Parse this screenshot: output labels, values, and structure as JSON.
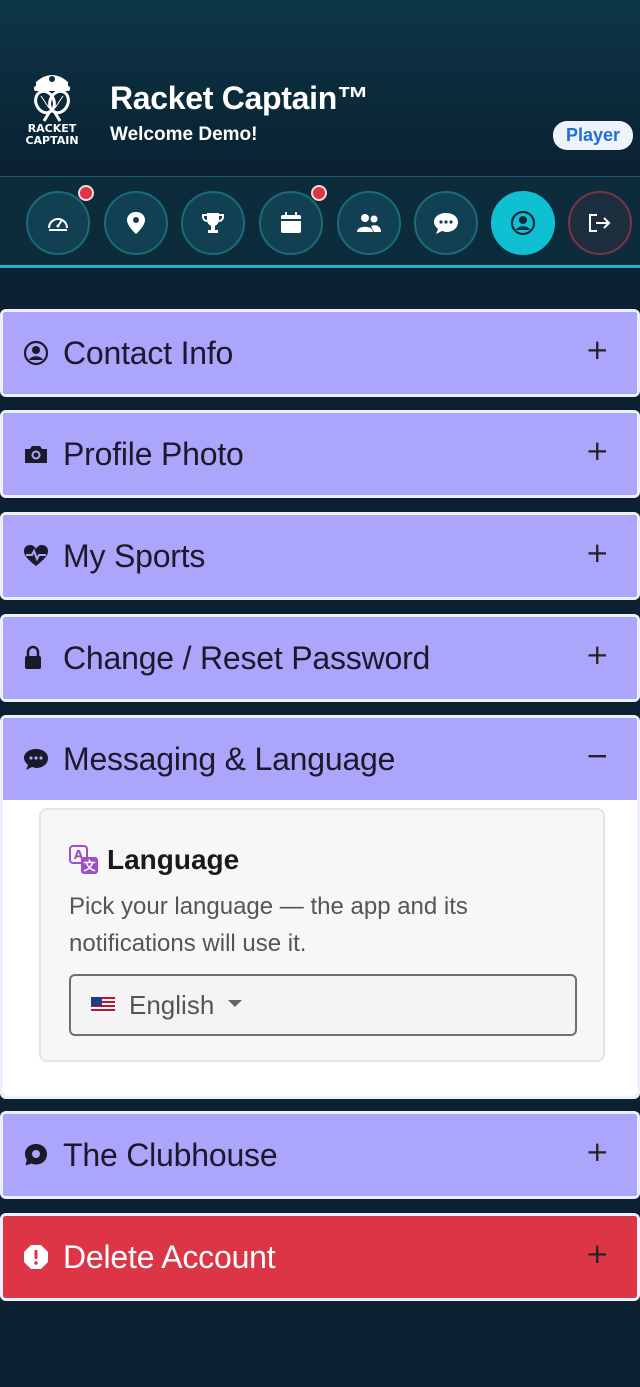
{
  "header": {
    "logo_text_line1": "RACKET",
    "logo_text_line2": "CAPTAIN",
    "title": "Racket Captain™",
    "welcome": "Welcome Demo!",
    "role_badge": "Player"
  },
  "nav": {
    "items": [
      {
        "icon": "speedometer-icon",
        "has_notification": true
      },
      {
        "icon": "location-pin-icon",
        "has_notification": false
      },
      {
        "icon": "trophy-icon",
        "has_notification": false
      },
      {
        "icon": "calendar-icon",
        "has_notification": true
      },
      {
        "icon": "people-icon",
        "has_notification": false
      },
      {
        "icon": "chat-icon",
        "has_notification": false
      },
      {
        "icon": "user-circle-icon",
        "active": true
      },
      {
        "icon": "logout-icon",
        "has_notification": false
      }
    ]
  },
  "sections": [
    {
      "label": "Contact Info",
      "icon": "user-circle-icon",
      "toggle": "+"
    },
    {
      "label": "Profile Photo",
      "icon": "camera-icon",
      "toggle": "+"
    },
    {
      "label": "My Sports",
      "icon": "heart-pulse-icon",
      "toggle": "+"
    },
    {
      "label": "Change / Reset Password",
      "icon": "lock-icon",
      "toggle": "+"
    },
    {
      "label": "Messaging & Language",
      "icon": "chat-dots-icon",
      "toggle": "−",
      "expanded": true
    },
    {
      "label": "The Clubhouse",
      "icon": "chat-bubble-icon",
      "toggle": "+"
    },
    {
      "label": "Delete Account",
      "icon": "exclamation-octagon-icon",
      "toggle": "+"
    }
  ],
  "language": {
    "title": "Language",
    "description": "Pick your language — the app and its notifications will use it.",
    "selected": "English",
    "flag": "us-flag-icon"
  },
  "colors": {
    "section_bg": "#aba5fc",
    "danger_bg": "#dc3545",
    "active_nav": "#0fc0d3",
    "badge_text": "#1f6fd6",
    "notification_dot": "#dc3545"
  }
}
